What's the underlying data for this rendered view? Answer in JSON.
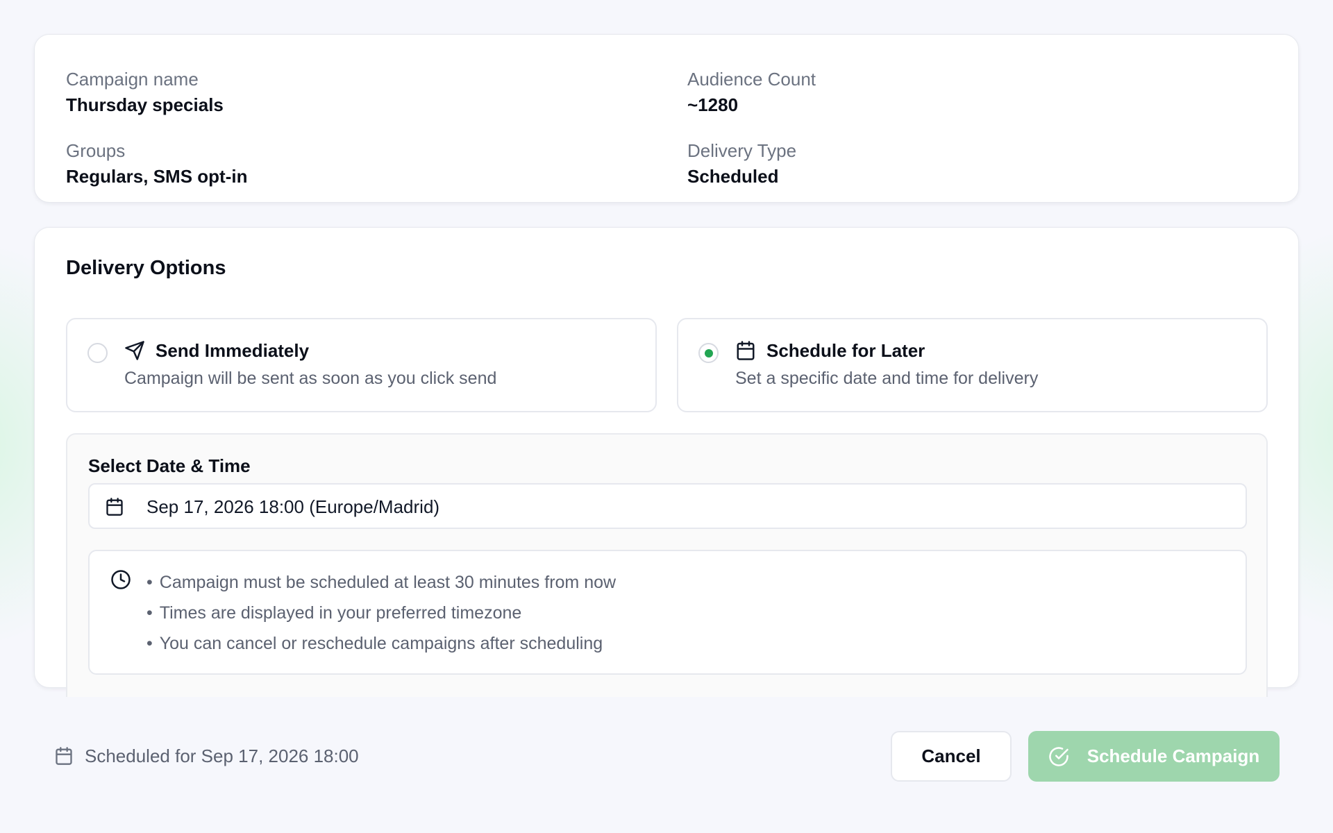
{
  "summary": {
    "campaign_name_label": "Campaign name",
    "campaign_name_value": "Thursday specials",
    "groups_label": "Groups",
    "groups_value": "Regulars, SMS opt-in",
    "audience_label": "Audience Count",
    "audience_value": "~1280",
    "delivery_type_label": "Delivery Type",
    "delivery_type_value": "Scheduled"
  },
  "delivery": {
    "title": "Delivery Options",
    "options": [
      {
        "title": "Send Immediately",
        "description": "Campaign will be sent as soon as you click send",
        "icon": "send-icon",
        "selected": false
      },
      {
        "title": "Schedule for Later",
        "description": "Set a specific date and time for delivery",
        "icon": "calendar-icon",
        "selected": true
      }
    ],
    "datetime_label": "Select Date & Time",
    "datetime_value": "Sep 17, 2026 18:00 (Europe/Madrid)",
    "rules": [
      "Campaign must be scheduled at least 30 minutes from now",
      "Times are displayed in your preferred timezone",
      "You can cancel or reschedule campaigns after scheduling"
    ]
  },
  "footer": {
    "status_text": "Scheduled for Sep 17, 2026 18:00",
    "cancel_label": "Cancel",
    "schedule_label": "Schedule Campaign"
  },
  "colors": {
    "accent_green": "#22a552",
    "schedule_button_disabled": "#9ed6ad"
  }
}
